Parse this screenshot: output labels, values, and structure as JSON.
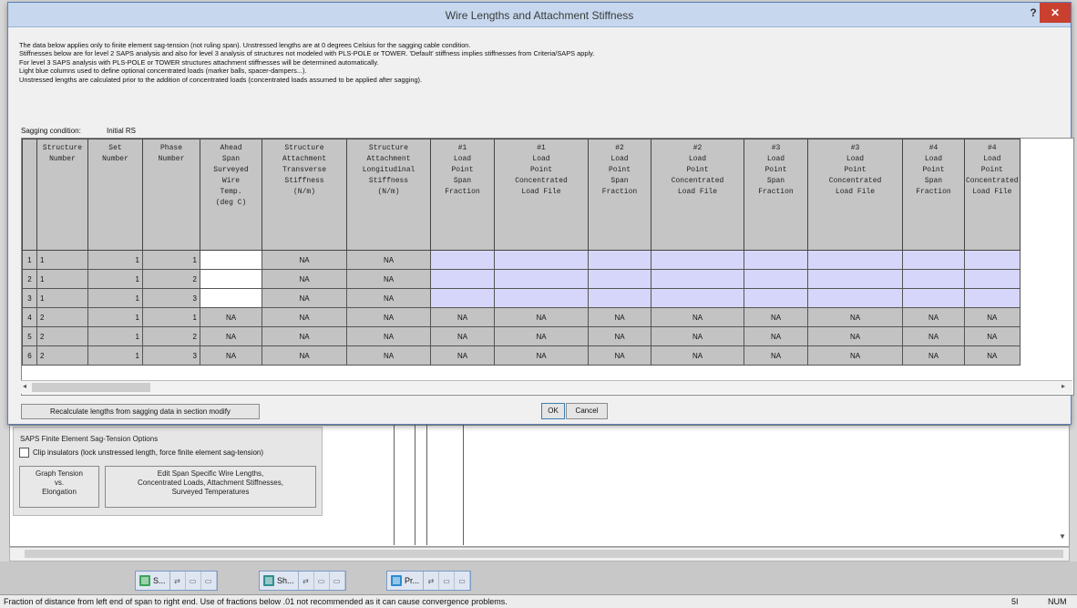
{
  "dialog": {
    "title": "Wire Lengths and Attachment Stiffness",
    "help_label": "?",
    "close_label": "✕",
    "notes": [
      "The data below applies only to finite element sag-tension (not ruling span). Unstressed lengths are at 0 degrees Celsius for the sagging cable condition.",
      "Stiffnesses below are for level 2 SAPS analysis and also for level 3 analysis of structures not modeled with PLS-POLE or TOWER. 'Default' stiffness implies stiffnesses from Criteria/SAPS apply.",
      "For level 3 SAPS analysis with PLS-POLE or TOWER structures attachment stiffnesses will be determined automatically.",
      "Light blue columns used to define optional concentrated loads (marker balls, spacer-dampers...).",
      "Unstressed lengths are calculated prior to the addition of concentrated loads (concentrated loads assumed to be applied after sagging)."
    ],
    "sagging_label": "Sagging condition:",
    "sagging_value": "Initial RS",
    "recalc_label": "Recalculate lengths from sagging data in section modify",
    "ok_label": "OK",
    "cancel_label": "Cancel"
  },
  "grid": {
    "columns": [
      "Structure\nNumber",
      "Set\nNumber",
      "Phase\nNumber",
      "Ahead\nSpan\nSurveyed\nWire\nTemp.\n(deg C)",
      "Structure\nAttachment\nTransverse\nStiffness\n(N/m)",
      "Structure\nAttachment\nLongitudinal\nStiffness\n(N/m)",
      "#1\nLoad\nPoint\nSpan\nFraction",
      "#1\nLoad\nPoint\nConcentrated\nLoad File",
      "#2\nLoad\nPoint\nSpan\nFraction",
      "#2\nLoad\nPoint\nConcentrated\nLoad File",
      "#3\nLoad\nPoint\nSpan\nFraction",
      "#3\nLoad\nPoint\nConcentrated\nLoad File",
      "#4\nLoad\nPoint\nSpan\nFraction",
      "#4\nLoad\nPoint\nConcentrated\nLoad File"
    ],
    "rows": [
      {
        "num": "1",
        "cells": [
          "1",
          "1",
          "1",
          "",
          "NA",
          "NA",
          "",
          "",
          "",
          "",
          "",
          "",
          "",
          ""
        ]
      },
      {
        "num": "2",
        "cells": [
          "1",
          "1",
          "2",
          "",
          "NA",
          "NA",
          "",
          "",
          "",
          "",
          "",
          "",
          "",
          ""
        ]
      },
      {
        "num": "3",
        "cells": [
          "1",
          "1",
          "3",
          "",
          "NA",
          "NA",
          "",
          "",
          "",
          "",
          "",
          "",
          "",
          ""
        ]
      },
      {
        "num": "4",
        "cells": [
          "2",
          "1",
          "1",
          "NA",
          "NA",
          "NA",
          "NA",
          "NA",
          "NA",
          "NA",
          "NA",
          "NA",
          "NA",
          "NA"
        ]
      },
      {
        "num": "5",
        "cells": [
          "2",
          "1",
          "2",
          "NA",
          "NA",
          "NA",
          "NA",
          "NA",
          "NA",
          "NA",
          "NA",
          "NA",
          "NA",
          "NA"
        ]
      },
      {
        "num": "6",
        "cells": [
          "2",
          "1",
          "3",
          "NA",
          "NA",
          "NA",
          "NA",
          "NA",
          "NA",
          "NA",
          "NA",
          "NA",
          "NA",
          "NA"
        ]
      }
    ]
  },
  "background": {
    "group_title": "SAPS Finite Element Sag-Tension Options",
    "clip_label": "Clip insulators (lock unstressed length, force finite element sag-tension)",
    "graph_button": "Graph Tension\nvs.\nElongation",
    "edit_button": "Edit Span Specific Wire Lengths,\nConcentrated Loads, Attachment Stiffnesses,\nSurveyed Temperatures"
  },
  "taskbar": {
    "apps": [
      {
        "label": "S...",
        "icon_color": "#3aa35a",
        "icon": "sheet-icon"
      },
      {
        "label": "Sh...",
        "icon_color": "#2f8f8f",
        "icon": "sheet-icon"
      },
      {
        "label": "Pr...",
        "icon_color": "#2a8bd0",
        "icon": "sheet-icon"
      }
    ],
    "small_buttons": [
      "⇄",
      "▭",
      "▭"
    ]
  },
  "statusbar": {
    "text": "Fraction of distance from left end of span to right end. Use of fractions below .01 not recommended as it can cause convergence problems.",
    "cell": "5I",
    "num": "NUM"
  }
}
